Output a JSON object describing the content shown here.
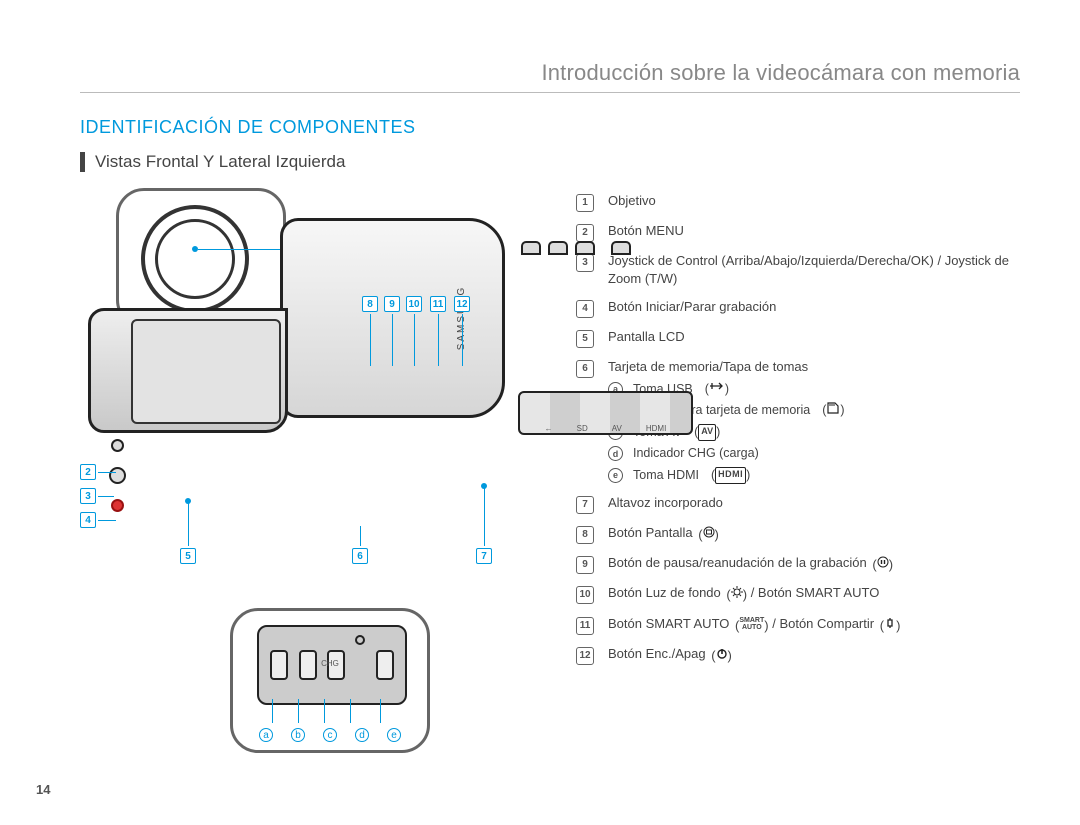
{
  "page": {
    "chapter_title": "Introducción sobre la videocámara con memoria",
    "section_title": "IDENTIFICACIÓN DE COMPONENTES",
    "subtitle": "Vistas Frontal Y Lateral Izquierda",
    "number": "14"
  },
  "colors": {
    "accent_blue": "#0099dd"
  },
  "callouts": {
    "numbers": [
      "1",
      "2",
      "3",
      "4",
      "5",
      "6",
      "7",
      "8",
      "9",
      "10",
      "11",
      "12"
    ],
    "letters": [
      "a",
      "b",
      "c",
      "d",
      "e"
    ]
  },
  "legend": {
    "items": [
      {
        "num": "1",
        "text": "Objetivo"
      },
      {
        "num": "2",
        "text": "Botón MENU"
      },
      {
        "num": "3",
        "text": "Joystick de Control (Arriba/Abajo/Izquierda/Derecha/OK) / Joystick de Zoom (T/W)"
      },
      {
        "num": "4",
        "text": "Botón Iniciar/Parar grabación"
      },
      {
        "num": "5",
        "text": "Pantalla LCD"
      },
      {
        "num": "6",
        "text": "Tarjeta de memoria/Tapa de tomas",
        "sub": [
          {
            "letter": "a",
            "text": "Toma USB",
            "icon": "usb-icon"
          },
          {
            "letter": "b",
            "text": "Ranura para tarjeta de memoria",
            "icon": "sd-icon"
          },
          {
            "letter": "c",
            "text": "Toma AV",
            "icon": "av-icon",
            "icon_text": "AV"
          },
          {
            "letter": "d",
            "text": "Indicador CHG (carga)"
          },
          {
            "letter": "e",
            "text": "Toma HDMI",
            "icon": "hdmi-icon",
            "icon_text": "HDMI"
          }
        ]
      },
      {
        "num": "7",
        "text": "Altavoz incorporado"
      },
      {
        "num": "8",
        "text": "Botón Pantalla",
        "icon": "display-icon"
      },
      {
        "num": "9",
        "text": "Botón de pausa/reanudación de la grabación",
        "icon": "pause-icon"
      },
      {
        "num": "10",
        "text": "Botón Luz de fondo",
        "icon": "backlight-icon",
        "suffix": " / Botón SMART AUTO"
      },
      {
        "num": "11",
        "text": "Botón SMART AUTO",
        "icon": "smartauto-icon",
        "icon_text": "SMART AUTO",
        "suffix": " / Botón Compartir",
        "icon2": "share-icon"
      },
      {
        "num": "12",
        "text": "Botón Enc./Apag",
        "icon": "power-icon"
      }
    ]
  }
}
